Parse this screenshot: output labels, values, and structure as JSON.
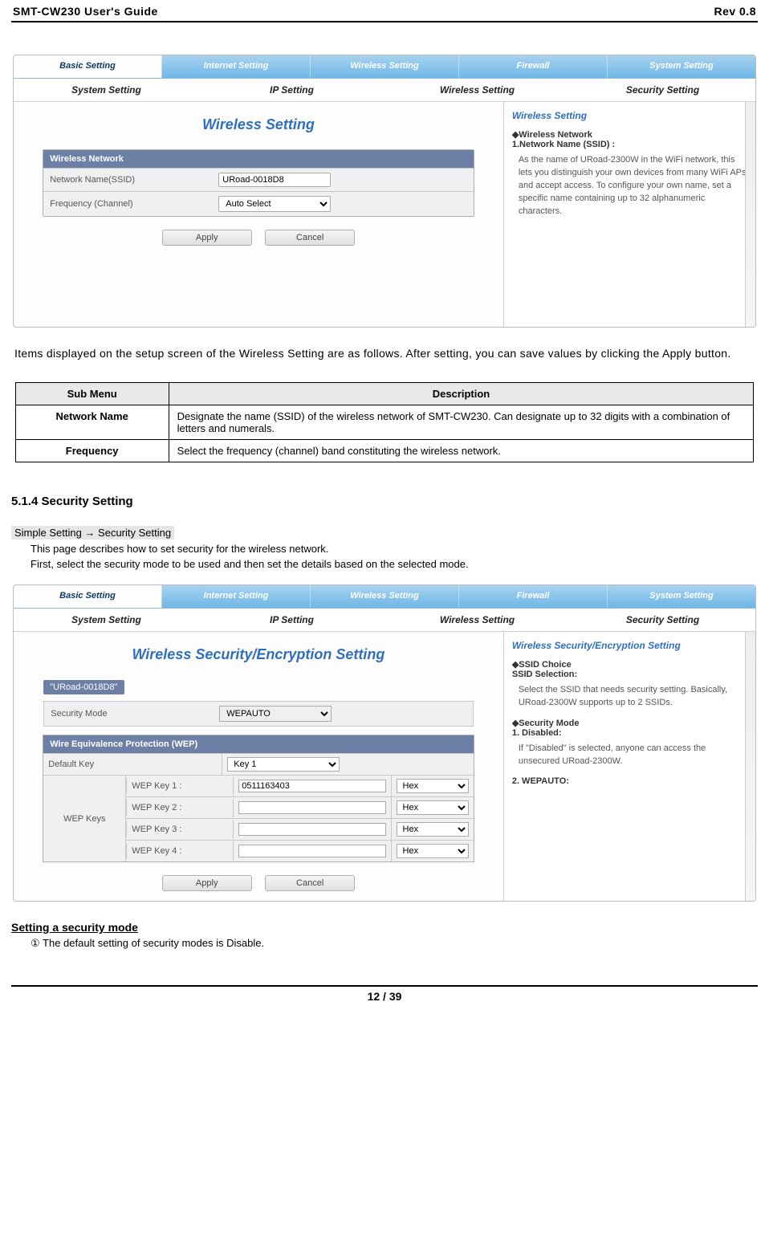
{
  "header": {
    "left": "SMT-CW230 User's Guide",
    "right": "Rev 0.8"
  },
  "tabs1": {
    "top": [
      "Basic Setting",
      "Internet Setting",
      "Wireless Setting",
      "Firewall",
      "System Setting"
    ],
    "sub": [
      "System Setting",
      "IP Setting",
      "Wireless Setting",
      "Security Setting"
    ]
  },
  "panel1": {
    "title": "Wireless Setting",
    "box_header": "Wireless Network",
    "row1_label": "Network Name(SSID)",
    "row1_value": "URoad-0018D8",
    "row2_label": "Frequency (Channel)",
    "row2_value": "Auto Select",
    "apply": "Apply",
    "cancel": "Cancel",
    "help_title": "Wireless Setting",
    "help_h1": "◆Wireless Network",
    "help_h2": "1.Network Name (SSID) :",
    "help_body": "As the name of URoad-2300W in the WiFi network, this lets you distinguish your own devices from many WiFi APs and accept access. To configure your own name, set a specific name containing up to 32 alphanumeric characters."
  },
  "para1": "Items displayed on the setup screen of the Wireless Setting are as follows. After setting, you can save values by clicking the Apply button.",
  "desc_table": {
    "headers": [
      "Sub Menu",
      "Description"
    ],
    "rows": [
      [
        "Network Name",
        "Designate the name (SSID) of the wireless network of SMT-CW230. Can designate up to 32 digits with a combination of letters and numerals."
      ],
      [
        "Frequency",
        "Select the frequency (channel) band constituting the wireless network."
      ]
    ]
  },
  "sec514": {
    "heading": "5.1.4 Security Setting",
    "crumb": "Simple Setting → Security Setting",
    "line1": "This page describes how to set security for the wireless network.",
    "line2": "First, select the security mode to be used and then set the details based on the selected mode."
  },
  "panel2": {
    "title": "Wireless Security/Encryption Setting",
    "chip": "\"URoad-0018D8\"",
    "secmode_lbl": "Security Mode",
    "secmode_val": "WEPAUTO",
    "wep_header": "Wire Equivalence Protection (WEP)",
    "defkey_lbl": "Default Key",
    "defkey_val": "Key 1",
    "keys_lbl": "WEP Keys",
    "keys": [
      {
        "lbl": "WEP Key 1 :",
        "val": "0511163403",
        "type": "Hex"
      },
      {
        "lbl": "WEP Key 2 :",
        "val": "",
        "type": "Hex"
      },
      {
        "lbl": "WEP Key 3 :",
        "val": "",
        "type": "Hex"
      },
      {
        "lbl": "WEP Key 4 :",
        "val": "",
        "type": "Hex"
      }
    ],
    "apply": "Apply",
    "cancel": "Cancel",
    "help_title": "Wireless Security/Encryption Setting",
    "h_ssid": "◆SSID Choice",
    "h_ssid2": "SSID Selection:",
    "h_ssid_body": "Select the SSID that needs security setting. Basically, URoad-2300W supports up to 2 SSIDs.",
    "h_sec": "◆Security Mode",
    "h_sec1": "1. Disabled:",
    "h_sec1_body": "If \"Disabled\" is selected, anyone can access the unsecured URoad-2300W.",
    "h_sec2": "2. WEPAUTO:"
  },
  "secmode_heading": "Setting a security mode",
  "secmode_item": "① The default setting of security modes is Disable.",
  "footer": "12 / 39"
}
